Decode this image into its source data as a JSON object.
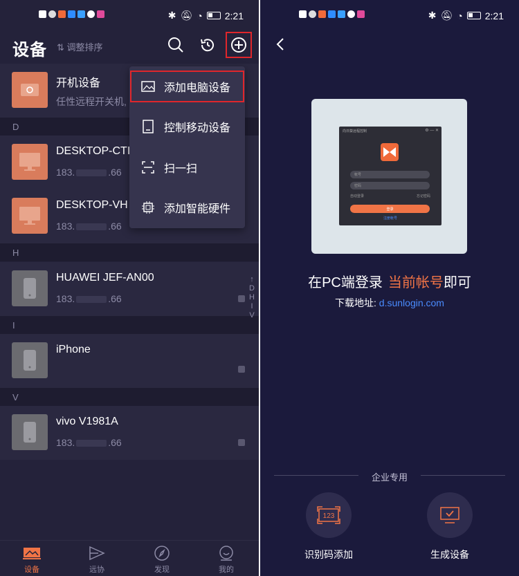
{
  "left": {
    "status": {
      "time": "2:21"
    },
    "header": {
      "title": "设备",
      "sort_label": "调整排序",
      "search_icon": "search-icon",
      "history_icon": "history-icon",
      "add_icon": "plus-circle-icon"
    },
    "devices": [
      {
        "name": "开机设备",
        "sub": "任性远程开关机,",
        "thumb": "power-icon"
      },
      {
        "name": "DESKTOP-CTI",
        "sub_prefix": "183.",
        "sub_suffix": ".66",
        "thumb": "monitor-icon"
      },
      {
        "name": "DESKTOP-VH",
        "sub_prefix": "183.",
        "sub_suffix": ".66",
        "thumb": "monitor-icon"
      },
      {
        "name": "HUAWEI JEF-AN00",
        "sub_prefix": "183.",
        "sub_suffix": ".66",
        "thumb": "phone-icon"
      },
      {
        "name": "iPhone",
        "thumb": "phone-icon"
      },
      {
        "name": "vivo V1981A",
        "sub_prefix": "183.",
        "sub_suffix": ".66",
        "thumb": "phone-icon"
      }
    ],
    "sections": [
      "D",
      "H",
      "I",
      "V"
    ],
    "index_bar": [
      "↑",
      "D",
      "H",
      "I",
      "V"
    ],
    "menu": [
      {
        "label": "添加电脑设备",
        "icon": "image-icon"
      },
      {
        "label": "控制移动设备",
        "icon": "tablet-icon"
      },
      {
        "label": "扫一扫",
        "icon": "scan-icon"
      },
      {
        "label": "添加智能硬件",
        "icon": "chip-icon"
      }
    ],
    "nav": [
      {
        "label": "设备",
        "icon": "devices-icon"
      },
      {
        "label": "远协",
        "icon": "remote-icon"
      },
      {
        "label": "发现",
        "icon": "compass-icon"
      },
      {
        "label": "我的",
        "icon": "profile-icon"
      }
    ]
  },
  "right": {
    "status": {
      "time": "2:21"
    },
    "preview": {
      "window_title": "向日葵远程控制",
      "account_placeholder": "帐号",
      "password_placeholder": "密码",
      "auto_login": "自动登录",
      "forgot": "忘记密码",
      "login": "登录",
      "register": "注册帐号"
    },
    "headline_prefix": "在PC端登录",
    "headline_highlight": "当前帐号",
    "headline_suffix": "即可",
    "download_label": "下载地址:",
    "download_url": "d.sunlogin.com",
    "enterprise_label": "企业专用",
    "ent_buttons": [
      {
        "label": "识别码添加",
        "icon": "code-123-icon",
        "code": "123"
      },
      {
        "label": "生成设备",
        "icon": "monitor-check-icon"
      }
    ]
  },
  "colors": {
    "accent": "#f07446",
    "link": "#4a8cff",
    "highlight_border": "#e0262b"
  }
}
